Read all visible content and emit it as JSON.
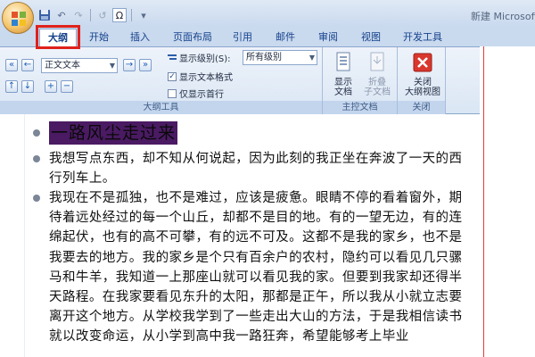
{
  "app": {
    "window_title": "新建 Microsoft"
  },
  "quick_access": {
    "items": [
      "save-icon",
      "undo-icon",
      "redo-icon",
      "symbol-icon",
      "customize-icon"
    ],
    "symbol_label": "Ω"
  },
  "tabs": [
    {
      "label": "大纲",
      "active": true
    },
    {
      "label": "开始",
      "active": false
    },
    {
      "label": "插入",
      "active": false
    },
    {
      "label": "页面布局",
      "active": false
    },
    {
      "label": "引用",
      "active": false
    },
    {
      "label": "邮件",
      "active": false
    },
    {
      "label": "审阅",
      "active": false
    },
    {
      "label": "视图",
      "active": false
    },
    {
      "label": "开发工具",
      "active": false
    }
  ],
  "ribbon": {
    "outline_tools": {
      "label": "大纲工具",
      "level_value": "正文文本",
      "show_level_label": "显示级别(S):",
      "show_level_value": "所有级别",
      "show_format_label": "显示文本格式",
      "show_format_checked": true,
      "first_line_label": "仅显示首行",
      "first_line_checked": false
    },
    "master_document": {
      "label": "主控文档",
      "show_doc_line1": "显示",
      "show_doc_line2": "文档",
      "collapse_line1": "折叠",
      "collapse_line2": "子文档"
    },
    "close_group": {
      "label": "关闭",
      "close_line1": "关闭",
      "close_line2": "大纲视图"
    }
  },
  "document": {
    "heading": "一路风尘走过来",
    "paragraphs": [
      "我想写点东西，却不知从何说起，因为此刻的我正坐在奔波了一天的西行列车上。",
      "我现在不是孤独，也不是难过，应该是疲惫。眼睛不停的看着窗外，期待着远处经过的每一个山丘，却都不是目的地。有的一望无边，有的连绵起伏，也有的高不可攀，有的远不可及。这都不是我的家乡，也不是我要去的地方。我的家乡是个只有百余户的农村，隐约可以看见几只骡马和牛羊，我知道一上那座山就可以看见我的家。但要到我家却还得半天路程。在我家要看见东升的太阳，那都是正午，所以我从小就立志要离开这个地方。从学校我学到了一些走出大山的方法，于是我相信读书就以改变命运，从小学到高中我一路狂奔，希望能够考上毕业"
    ]
  },
  "colors": {
    "accent_red": "#e0211c",
    "tab_text": "#15428b",
    "heading_highlight": "#4a1a63"
  }
}
